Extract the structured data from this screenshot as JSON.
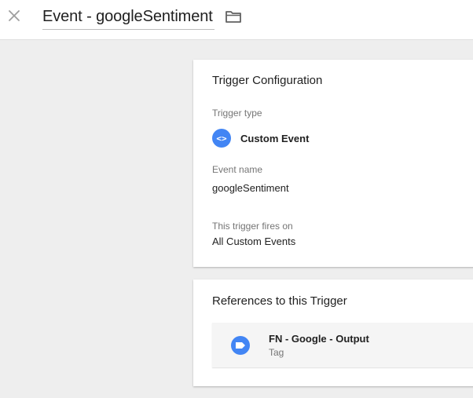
{
  "header": {
    "title": "Event - googleSentiment",
    "close_icon": "close-icon",
    "folder_icon": "folder-icon"
  },
  "trigger_config": {
    "title": "Trigger Configuration",
    "trigger_type_label": "Trigger type",
    "trigger_type_value": "Custom Event",
    "trigger_type_icon": "code-brackets-icon",
    "trigger_type_icon_text": "<>",
    "event_name_label": "Event name",
    "event_name_value": "googleSentiment",
    "fires_on_label": "This trigger fires on",
    "fires_on_value": "All Custom Events"
  },
  "references": {
    "title": "References to this Trigger",
    "items": [
      {
        "name": "FN - Google - Output",
        "type": "Tag",
        "icon": "tag-icon"
      }
    ]
  },
  "colors": {
    "accent": "#4285f4",
    "page_background": "#eeeeee",
    "card_background": "#ffffff",
    "secondary_text": "#757575"
  }
}
